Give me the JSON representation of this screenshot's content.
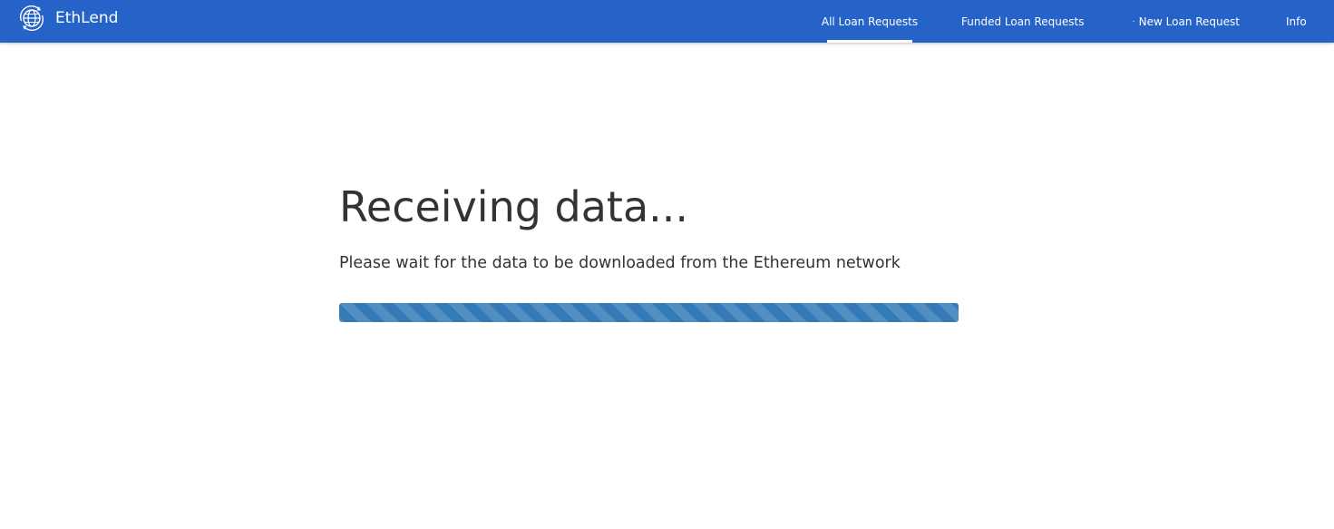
{
  "colors": {
    "navbar": "#2563c9",
    "progress": "#337ab7",
    "text": "#333333"
  },
  "brand": {
    "name": "EthLend",
    "icon": "globe-refresh-icon"
  },
  "nav": {
    "all_loan_requests": "All Loan Requests",
    "funded_loan_requests": "Funded Loan Requests",
    "new_loan_request": "New Loan Request",
    "new_loan_request_icon": "plus-circle-icon",
    "info": "Info",
    "active": "All Loan Requests"
  },
  "main": {
    "title": "Receiving data...",
    "subtitle": "Please wait for the data to be downloaded from the Ethereum network",
    "progress_percent": 100,
    "progress_style": "striped"
  }
}
